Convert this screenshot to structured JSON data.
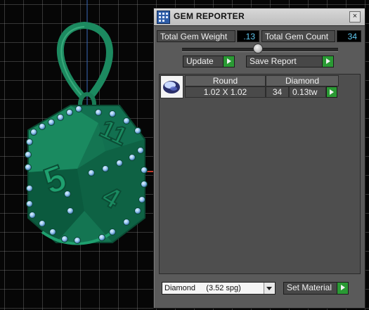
{
  "window": {
    "title": "GEM REPORTER",
    "close_label": "×"
  },
  "totals": {
    "weight_label": "Total Gem Weight",
    "weight_value": ".13",
    "count_label": "Total Gem Count",
    "count_value": "34"
  },
  "buttons": {
    "update_label": "Update",
    "save_report_label": "Save Report",
    "set_material_label": "Set Material"
  },
  "table": {
    "headers": [
      "Round",
      "Diamond"
    ],
    "rows": [
      {
        "size": "1.02 X 1.02",
        "count": "34",
        "weight": "0.13tw"
      }
    ]
  },
  "material": {
    "selected": "Diamond     (3.52 spg)"
  },
  "viewport": {
    "model_numbers": [
      "5",
      "11",
      "4"
    ],
    "model_color": "#1f8f63",
    "gem_color": "#8fc0ec"
  },
  "icons": {
    "app": "gem-reporter-icon",
    "close": "close-icon",
    "slider": "slider-thumb",
    "row_go": "play-arrow-icon",
    "gem": "round-gem-icon",
    "dropdown": "chevron-down-icon"
  }
}
